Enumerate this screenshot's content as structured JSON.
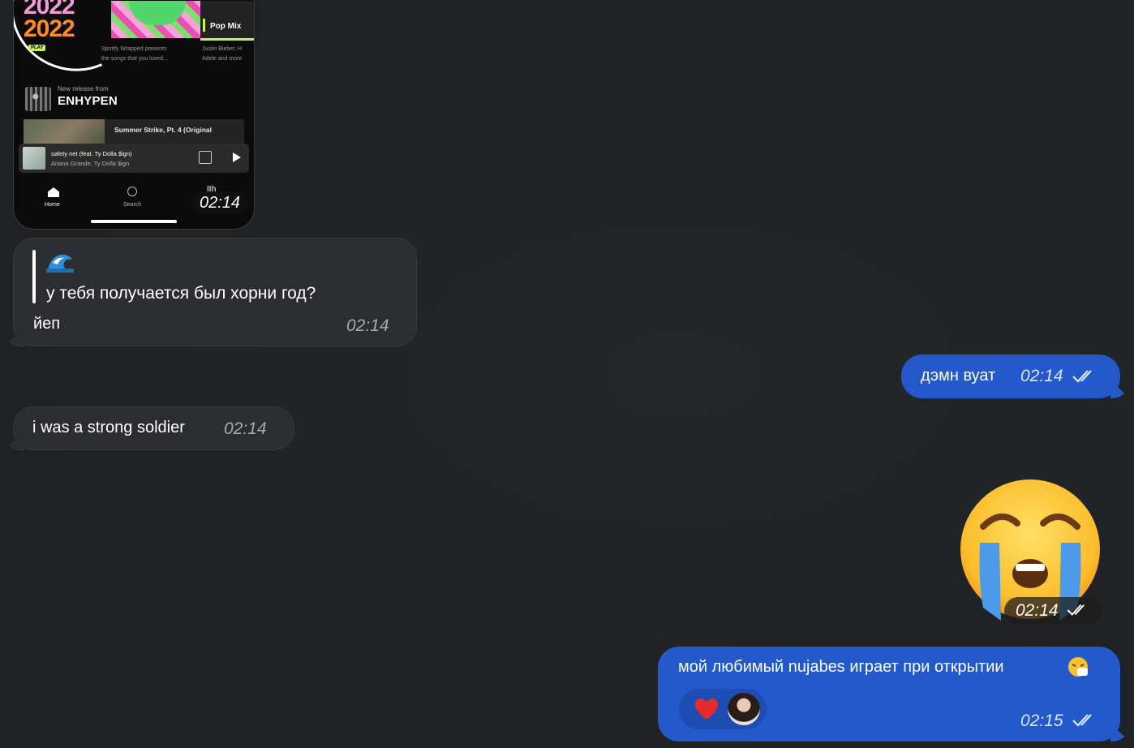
{
  "phone_screenshot": {
    "tile1_year_a": "2022",
    "tile1_year_b": "2022",
    "tile1_tag": "PLAY",
    "tile2_caption": "Spotify Wrapped presents\nthe songs that you loved...",
    "tile3_label": "Pop Mix",
    "tile3_caption": "Justin Bieber, H\nAdele and more",
    "release_small": "New release from",
    "release_artist": "ENHYPEN",
    "strike_title": "Summer Strike, Pt. 4 (Original",
    "mini_title": "safety net (feat. Ty Dolla $ign)",
    "mini_artist": "Ariana Grande, Ty Dolla $ign",
    "nav_home": "Home",
    "nav_search": "Search",
    "nav_library": "IIh",
    "time": "02:14"
  },
  "messages_in": [
    {
      "quote": "у тебя получается был хорни год?",
      "text": "йеп",
      "time": "02:14"
    },
    {
      "text": "i was a strong soldier",
      "time": "02:14"
    }
  ],
  "messages_out": [
    {
      "text": "дэмн вуат",
      "time": "02:14"
    },
    {
      "sticker": "crying-face",
      "time": "02:14"
    },
    {
      "text": "мой любимый nujabes играет при открытии",
      "time": "02:15",
      "reaction": "heart"
    }
  ],
  "colors": {
    "background": "#1f2124",
    "incoming": "#2c2d30",
    "outgoing": "#2459cc"
  }
}
